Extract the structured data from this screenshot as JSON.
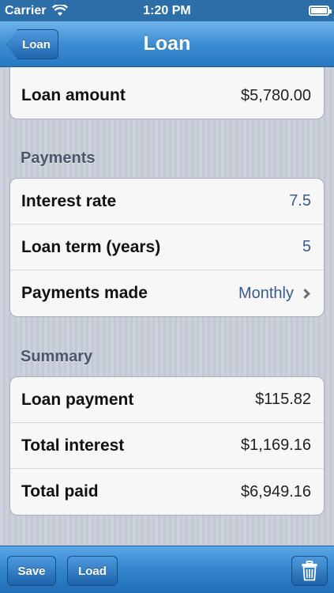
{
  "status_bar": {
    "carrier": "Carrier",
    "time": "1:20 PM"
  },
  "nav": {
    "title": "Loan",
    "back_label": "Loan"
  },
  "loan": {
    "amount_label": "Loan amount",
    "amount_value": "$5,780.00"
  },
  "payments": {
    "header": "Payments",
    "rows": [
      {
        "label": "Interest rate",
        "value": "7.5"
      },
      {
        "label": "Loan term (years)",
        "value": "5"
      },
      {
        "label": "Payments made",
        "value": "Monthly"
      }
    ]
  },
  "summary": {
    "header": "Summary",
    "rows": [
      {
        "label": "Loan payment",
        "value": "$115.82"
      },
      {
        "label": "Total interest",
        "value": "$1,169.16"
      },
      {
        "label": "Total paid",
        "value": "$6,949.16"
      }
    ]
  },
  "toolbar": {
    "save_label": "Save",
    "load_label": "Load"
  },
  "icons": {
    "signal": "wifi-icon",
    "battery": "battery-icon",
    "disclosure": "chevron-right-icon",
    "delete": "trash-icon"
  },
  "colors": {
    "bar_blue": "#2c6fa8",
    "value_blue": "#3a5a8c"
  }
}
